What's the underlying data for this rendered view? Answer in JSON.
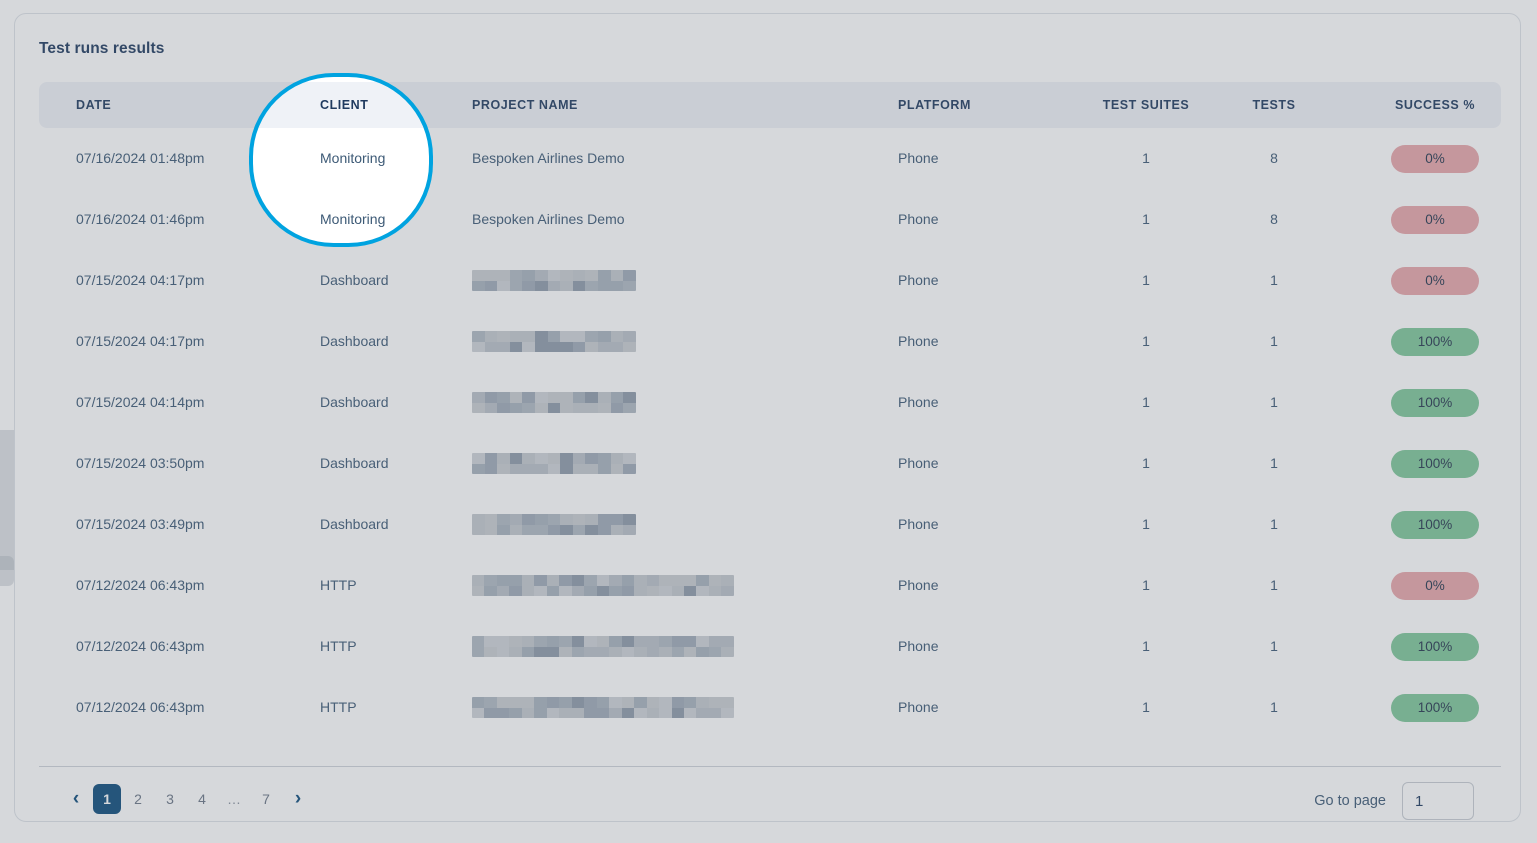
{
  "card": {
    "title": "Test runs results"
  },
  "table": {
    "columns": [
      {
        "key": "date",
        "label": "DATE"
      },
      {
        "key": "client",
        "label": "CLIENT"
      },
      {
        "key": "project",
        "label": "PROJECT NAME"
      },
      {
        "key": "platform",
        "label": "PLATFORM"
      },
      {
        "key": "suites",
        "label": "TEST SUITES"
      },
      {
        "key": "tests",
        "label": "TESTS"
      },
      {
        "key": "success",
        "label": "SUCCESS %"
      }
    ],
    "rows": [
      {
        "date": "07/16/2024 01:48pm",
        "client": "Monitoring",
        "project": "Bespoken Airlines Demo",
        "project_redacted": false,
        "platform": "Phone",
        "suites": "1",
        "tests": "8",
        "success": "0%",
        "success_state": "fail"
      },
      {
        "date": "07/16/2024 01:46pm",
        "client": "Monitoring",
        "project": "Bespoken Airlines Demo",
        "project_redacted": false,
        "platform": "Phone",
        "suites": "1",
        "tests": "8",
        "success": "0%",
        "success_state": "fail"
      },
      {
        "date": "07/15/2024 04:17pm",
        "client": "Dashboard",
        "project": "",
        "project_redacted": true,
        "platform": "Phone",
        "suites": "1",
        "tests": "1",
        "success": "0%",
        "success_state": "fail"
      },
      {
        "date": "07/15/2024 04:17pm",
        "client": "Dashboard",
        "project": "",
        "project_redacted": true,
        "platform": "Phone",
        "suites": "1",
        "tests": "1",
        "success": "100%",
        "success_state": "success"
      },
      {
        "date": "07/15/2024 04:14pm",
        "client": "Dashboard",
        "project": "",
        "project_redacted": true,
        "platform": "Phone",
        "suites": "1",
        "tests": "1",
        "success": "100%",
        "success_state": "success"
      },
      {
        "date": "07/15/2024 03:50pm",
        "client": "Dashboard",
        "project": "",
        "project_redacted": true,
        "platform": "Phone",
        "suites": "1",
        "tests": "1",
        "success": "100%",
        "success_state": "success"
      },
      {
        "date": "07/15/2024 03:49pm",
        "client": "Dashboard",
        "project": "",
        "project_redacted": true,
        "platform": "Phone",
        "suites": "1",
        "tests": "1",
        "success": "100%",
        "success_state": "success"
      },
      {
        "date": "07/12/2024 06:43pm",
        "client": "HTTP",
        "project": "",
        "project_redacted": true,
        "platform": "Phone",
        "suites": "1",
        "tests": "1",
        "success": "0%",
        "success_state": "fail"
      },
      {
        "date": "07/12/2024 06:43pm",
        "client": "HTTP",
        "project": "",
        "project_redacted": true,
        "platform": "Phone",
        "suites": "1",
        "tests": "1",
        "success": "100%",
        "success_state": "success"
      },
      {
        "date": "07/12/2024 06:43pm",
        "client": "HTTP",
        "project": "",
        "project_redacted": true,
        "platform": "Phone",
        "suites": "1",
        "tests": "1",
        "success": "100%",
        "success_state": "success"
      }
    ],
    "redacted_widths": [
      164,
      164,
      164,
      164,
      164,
      262,
      262,
      262
    ]
  },
  "pagination": {
    "prev_icon": "‹",
    "next_icon": "›",
    "pages": [
      "1",
      "2",
      "3",
      "4",
      "…",
      "7"
    ],
    "active_page": "1"
  },
  "goto": {
    "label": "Go to page",
    "value": "1",
    "placeholder": "1"
  },
  "spotlight": {
    "target_column": "CLIENT",
    "ring_color": "#00a3e0"
  },
  "colors": {
    "accent_blue": "#00a3e0",
    "pagination_active": "#0d4c7c",
    "badge_fail": "#e8a7ab",
    "badge_success": "#7fc79a",
    "header_bg": "#eff2f7",
    "text_primary": "#1f3a5f"
  }
}
